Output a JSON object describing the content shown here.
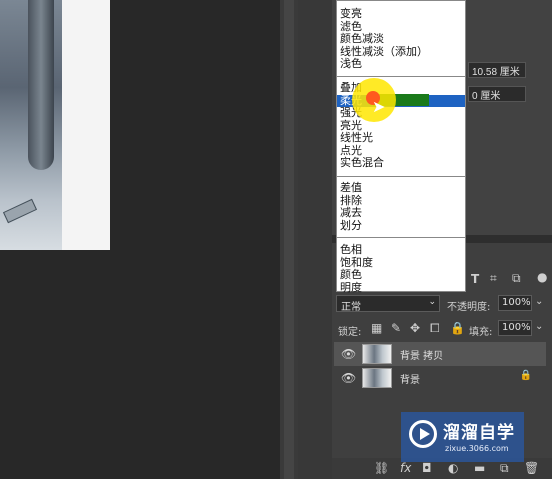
{
  "blend_menu": {
    "group1": [
      "变亮",
      "滤色",
      "颜色减淡",
      "线性减淡（添加）",
      "浅色"
    ],
    "group2": [
      "叠加",
      "柔光",
      "强光",
      "亮光",
      "线性光",
      "点光",
      "实色混合"
    ],
    "group3": [
      "差值",
      "排除",
      "减去",
      "划分"
    ],
    "group4": [
      "色相",
      "饱和度",
      "颜色",
      "明度"
    ],
    "highlighted": "柔光"
  },
  "properties": {
    "width_value": "10.58 厘米",
    "offset_value": "0 厘米"
  },
  "layers_panel": {
    "blend_mode": "正常",
    "opacity_label": "不透明度:",
    "opacity_value": "100%",
    "lock_label": "锁定:",
    "fill_label": "填充:",
    "fill_value": "100%",
    "layers": [
      {
        "name": "背景 拷贝",
        "active": true,
        "locked": false
      },
      {
        "name": "背景",
        "active": false,
        "locked": true
      }
    ]
  },
  "watermark": {
    "title": "溜溜自学",
    "url": "zixue.3066.com"
  },
  "icons": [
    "eye-icon",
    "lock-icon",
    "mouse-pointer-icon",
    "type-icon",
    "play-logo-icon"
  ]
}
